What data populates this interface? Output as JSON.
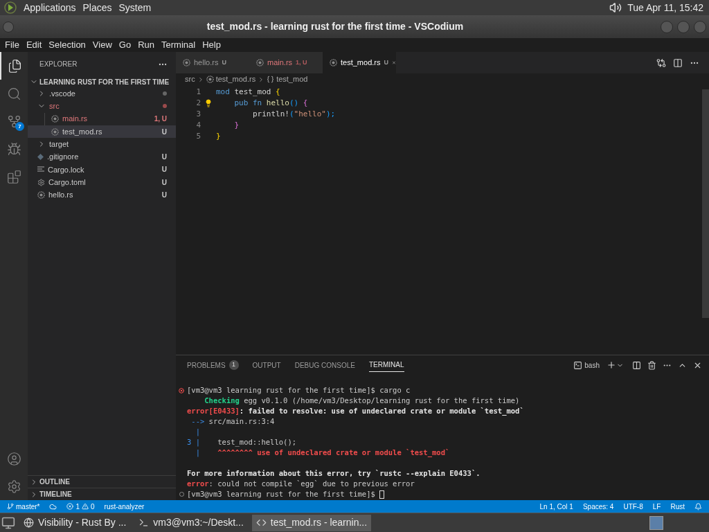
{
  "top_panel": {
    "menus": [
      "Applications",
      "Places",
      "System"
    ],
    "clock": "Tue Apr 11, 15:42"
  },
  "window": {
    "title": "test_mod.rs - learning rust for the first time - VSCodium"
  },
  "menu_bar": [
    "File",
    "Edit",
    "Selection",
    "View",
    "Go",
    "Run",
    "Terminal",
    "Help"
  ],
  "activity_bar": {
    "items": [
      {
        "kind": "explorer",
        "selected": true
      },
      {
        "kind": "search",
        "selected": false
      },
      {
        "kind": "source-control",
        "selected": false,
        "badge": "7"
      },
      {
        "kind": "run",
        "selected": false
      },
      {
        "kind": "extensions",
        "selected": false
      }
    ],
    "bottom": [
      {
        "kind": "accounts"
      },
      {
        "kind": "manage"
      }
    ]
  },
  "sidebar": {
    "title": "EXPLORER",
    "root": {
      "name": "LEARNING RUST FOR THE FIRST TIME",
      "expanded": true,
      "children": [
        {
          "name": ".vscode",
          "kind": "folder",
          "expanded": false,
          "error": false,
          "dot": true
        },
        {
          "name": "src",
          "kind": "folder",
          "expanded": true,
          "error": true,
          "dot": true,
          "children": [
            {
              "name": "main.rs",
              "kind": "rust",
              "error": true,
              "status": "1, U",
              "selected": false
            },
            {
              "name": "test_mod.rs",
              "kind": "rust",
              "error": false,
              "status": "U",
              "selected": true
            }
          ]
        },
        {
          "name": "target",
          "kind": "folder",
          "expanded": false,
          "error": false,
          "dot": false
        },
        {
          "name": ".gitignore",
          "kind": "git",
          "error": false,
          "status": "U",
          "selected": false
        },
        {
          "name": "Cargo.lock",
          "kind": "lock",
          "error": false,
          "status": "U",
          "selected": false
        },
        {
          "name": "Cargo.toml",
          "kind": "toml",
          "error": false,
          "status": "U",
          "selected": false
        },
        {
          "name": "hello.rs",
          "kind": "rust",
          "error": false,
          "status": "U",
          "selected": false
        }
      ]
    },
    "sections": [
      {
        "label": "OUTLINE",
        "expanded": false
      },
      {
        "label": "TIMELINE",
        "expanded": false
      }
    ]
  },
  "tabs": [
    {
      "name": "hello.rs",
      "status": "U",
      "error": false,
      "selected": false
    },
    {
      "name": "main.rs",
      "status": "1, U",
      "error": true,
      "selected": false
    },
    {
      "name": "test_mod.rs",
      "status": "U",
      "error": false,
      "selected": true
    }
  ],
  "breadcrumbs": [
    {
      "text": "src",
      "kind": "folder"
    },
    {
      "text": "test_mod.rs",
      "kind": "file"
    },
    {
      "text": "test_mod",
      "kind": "module"
    }
  ],
  "code": [
    {
      "number": "1",
      "lightbulb": false,
      "tokens": [
        {
          "text": "mod",
          "kind": "keyword"
        },
        {
          "text": " test_mod ",
          "kind": "ident"
        },
        {
          "text": "{",
          "kind": "brace"
        }
      ]
    },
    {
      "number": "2",
      "lightbulb": true,
      "tokens": [
        {
          "text": "    pub fn",
          "kind": "keyword"
        },
        {
          "text": " hello",
          "kind": "function"
        },
        {
          "text": "()",
          "kind": "paren"
        },
        {
          "text": " {",
          "kind": "brace2"
        }
      ]
    },
    {
      "number": "3",
      "lightbulb": false,
      "tokens": [
        {
          "text": "        println!",
          "kind": "ident"
        },
        {
          "text": "(",
          "kind": "paren"
        },
        {
          "text": "\"hello\"",
          "kind": "string"
        },
        {
          "text": ");",
          "kind": "paren"
        }
      ]
    },
    {
      "number": "4",
      "lightbulb": false,
      "tokens": [
        {
          "text": "    }",
          "kind": "brace2"
        }
      ]
    },
    {
      "number": "5",
      "lightbulb": false,
      "tokens": [
        {
          "text": "}",
          "kind": "brace"
        }
      ]
    }
  ],
  "panel": {
    "tabs": [
      {
        "label": "PROBLEMS",
        "count": "1",
        "selected": false
      },
      {
        "label": "OUTPUT",
        "selected": false
      },
      {
        "label": "DEBUG CONSOLE",
        "selected": false
      },
      {
        "label": "TERMINAL",
        "selected": true
      }
    ],
    "shell": "bash",
    "terminal": [
      {
        "kind": "command",
        "failed": true,
        "segments": [
          {
            "text": "[vm3@vm3 learning rust for the first time]$ cargo c",
            "kind": "plain"
          }
        ]
      },
      {
        "kind": "output",
        "segments": [
          {
            "text": "    Checking",
            "kind": "green"
          },
          {
            "text": " egg v0.1.0 (/home/vm3/Desktop/learning rust for the first time)",
            "kind": "plain"
          }
        ]
      },
      {
        "kind": "output",
        "segments": [
          {
            "text": "error[E0433]",
            "kind": "red"
          },
          {
            "text": ": failed to resolve: use of undeclared crate or module `test_mod`",
            "kind": "bold"
          }
        ]
      },
      {
        "kind": "output",
        "segments": [
          {
            "text": " --> ",
            "kind": "blue"
          },
          {
            "text": "src/main.rs:3:4",
            "kind": "plain"
          }
        ]
      },
      {
        "kind": "output",
        "segments": [
          {
            "text": "  |",
            "kind": "blue"
          }
        ]
      },
      {
        "kind": "output",
        "segments": [
          {
            "text": "3 |",
            "kind": "blue"
          },
          {
            "text": "    test_mod::hello();",
            "kind": "plain"
          }
        ]
      },
      {
        "kind": "output",
        "segments": [
          {
            "text": "  |",
            "kind": "blue"
          },
          {
            "text": "    ^^^^^^^^ use of undeclared crate or module `test_mod`",
            "kind": "red"
          }
        ]
      },
      {
        "kind": "blank"
      },
      {
        "kind": "output",
        "segments": [
          {
            "text": "For more information about this error, try `rustc --explain E0433`.",
            "kind": "bold"
          }
        ]
      },
      {
        "kind": "output",
        "segments": [
          {
            "text": "error",
            "kind": "red"
          },
          {
            "text": ": could not compile `egg` due to previous error",
            "kind": "plain"
          }
        ]
      },
      {
        "kind": "command",
        "failed": false,
        "cursor": true,
        "segments": [
          {
            "text": "[vm3@vm3 learning rust for the first time]$ ",
            "kind": "plain"
          }
        ]
      }
    ]
  },
  "status_bar": {
    "branch": "master*",
    "errors": "1",
    "warnings": "0",
    "left_items": [
      "rust-analyzer"
    ],
    "right_items": [
      "Ln 1, Col 1",
      "Spaces: 4",
      "UTF-8",
      "LF",
      "Rust"
    ]
  },
  "taskbar": [
    {
      "label": "Visibility - Rust By ...",
      "kind": "browser",
      "selected": false
    },
    {
      "label": "vm3@vm3:~/Deskt...",
      "kind": "terminal",
      "selected": false
    },
    {
      "label": "test_mod.rs - learnin...",
      "kind": "editor",
      "selected": true
    }
  ]
}
